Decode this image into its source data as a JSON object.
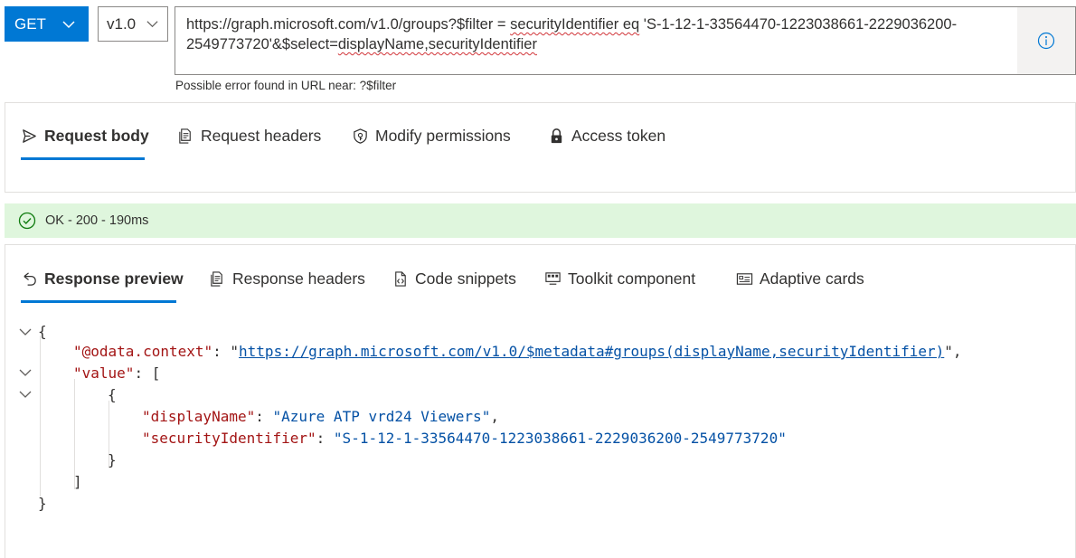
{
  "request": {
    "method": "GET",
    "version": "v1.0",
    "url_line1_a": "https://graph.microsoft.com/v1.0/groups?$filter =",
    "url_line1_b": "securityIdentifier eq",
    "url_line1_c": " 'S-1-12-1-33564470-1223038661-2229036200-",
    "url_line2_a": "2549773720'&$select=",
    "url_line2_b": "displayName,securityIdentifier",
    "url_error": "Possible error found in URL near: ?$filter"
  },
  "request_tabs": [
    {
      "label": "Request body",
      "icon": "send-icon"
    },
    {
      "label": "Request headers",
      "icon": "document-icon"
    },
    {
      "label": "Modify permissions",
      "icon": "shield-key-icon"
    },
    {
      "label": "Access token",
      "icon": "lock-icon"
    }
  ],
  "status": {
    "text": "OK - 200 - 190ms",
    "color": "#dff6dd"
  },
  "response_tabs": [
    {
      "label": "Response preview",
      "icon": "undo-icon"
    },
    {
      "label": "Response headers",
      "icon": "document-icon"
    },
    {
      "label": "Code snippets",
      "icon": "code-file-icon"
    },
    {
      "label": "Toolkit component",
      "icon": "toolkit-icon"
    },
    {
      "label": "Adaptive cards",
      "icon": "card-icon"
    }
  ],
  "response": {
    "open_brace": "{",
    "close_brace": "}",
    "context_key": "\"@odata.context\"",
    "context_value": "https://graph.microsoft.com/v1.0/$metadata#groups(displayName,securityIdentifier)",
    "value_key": "\"value\"",
    "open_bracket": "[",
    "close_bracket": "]",
    "item_open": "{",
    "item_close": "}",
    "display_name_key": "\"displayName\"",
    "display_name_value": "\"Azure ATP vrd24 Viewers\"",
    "security_id_key": "\"securityIdentifier\"",
    "security_id_value": "\"S-1-12-1-33564470-1223038661-2229036200-2549773720\""
  },
  "colors": {
    "accent": "#0078d4",
    "json_key": "#a31515",
    "json_string": "#0451a5"
  }
}
